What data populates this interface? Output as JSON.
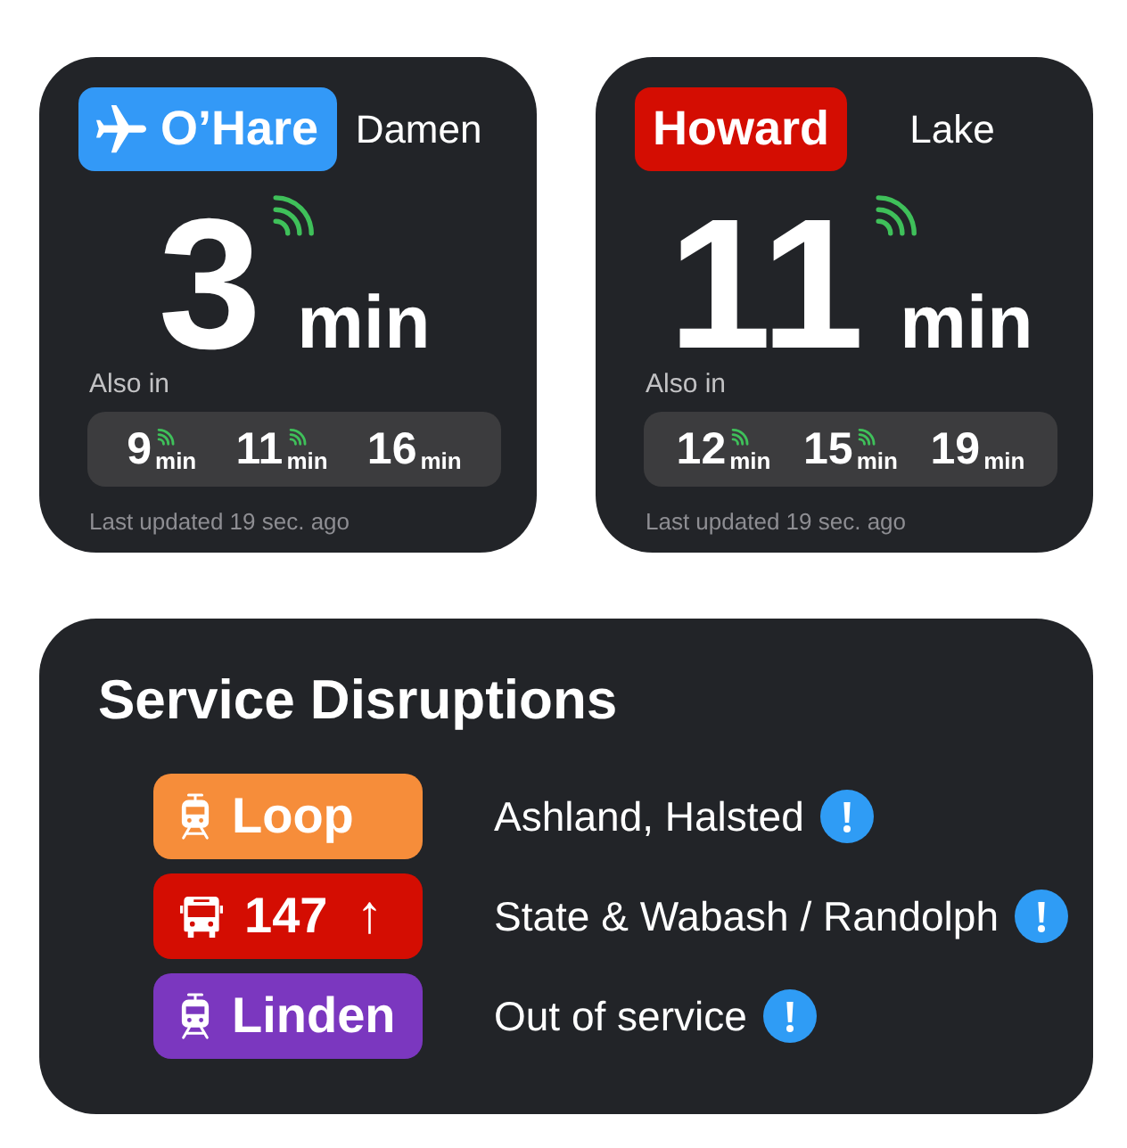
{
  "arrival_cards": [
    {
      "route": {
        "label": "O’Hare",
        "color": "#3399f7",
        "airport": true
      },
      "station": "Damen",
      "next": {
        "value": "3",
        "unit": "min",
        "realtime": true
      },
      "also_in": "Also in",
      "upcoming": [
        {
          "value": "9",
          "unit": "min",
          "realtime": true
        },
        {
          "value": "11",
          "unit": "min",
          "realtime": true
        },
        {
          "value": "16",
          "unit": "min",
          "realtime": false
        }
      ],
      "last_updated": "Last updated 19 sec. ago"
    },
    {
      "route": {
        "label": "Howard",
        "color": "#d40d02",
        "airport": false
      },
      "station": "Lake",
      "next": {
        "value": "11",
        "unit": "min",
        "realtime": true
      },
      "also_in": "Also in",
      "upcoming": [
        {
          "value": "12",
          "unit": "min",
          "realtime": true
        },
        {
          "value": "15",
          "unit": "min",
          "realtime": true
        },
        {
          "value": "19",
          "unit": "min",
          "realtime": false
        }
      ],
      "last_updated": "Last updated 19 sec. ago"
    }
  ],
  "service_disruptions": {
    "title": "Service Disruptions",
    "items": [
      {
        "route": {
          "kind": "train",
          "label": "Loop",
          "color": "#f68d3a"
        },
        "description": "Ashland, Halsted"
      },
      {
        "route": {
          "kind": "bus",
          "label": "147",
          "direction": "↑",
          "color": "#d40d02"
        },
        "description": "State & Wabash / Randolph"
      },
      {
        "route": {
          "kind": "train",
          "label": "Linden",
          "color": "#7b37bf"
        },
        "description": "Out of service"
      }
    ]
  }
}
